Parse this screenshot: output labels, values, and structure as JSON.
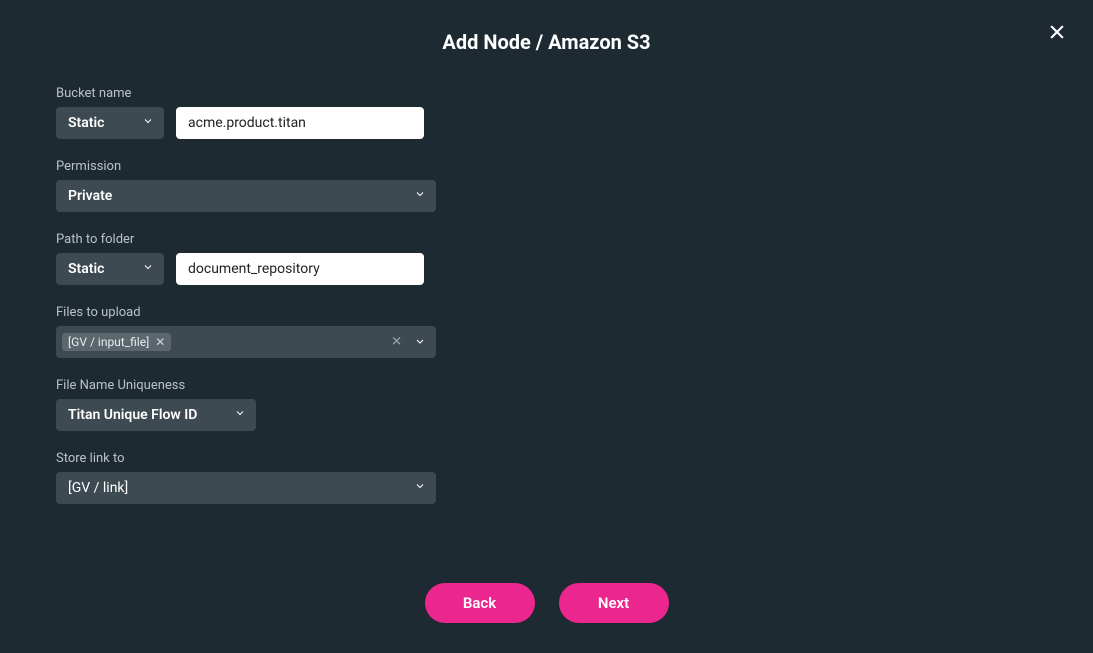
{
  "title": "Add Node / Amazon S3",
  "fields": {
    "bucket": {
      "label": "Bucket name",
      "mode": "Static",
      "value": "acme.product.titan"
    },
    "permission": {
      "label": "Permission",
      "value": "Private"
    },
    "path": {
      "label": "Path to folder",
      "mode": "Static",
      "value": "document_repository"
    },
    "files": {
      "label": "Files to upload",
      "chip": "[GV / input_file]"
    },
    "uniqueness": {
      "label": "File Name Uniqueness",
      "value": "Titan Unique Flow ID"
    },
    "storelink": {
      "label": "Store link to",
      "value": "[GV / link]"
    }
  },
  "buttons": {
    "back": "Back",
    "next": "Next"
  }
}
